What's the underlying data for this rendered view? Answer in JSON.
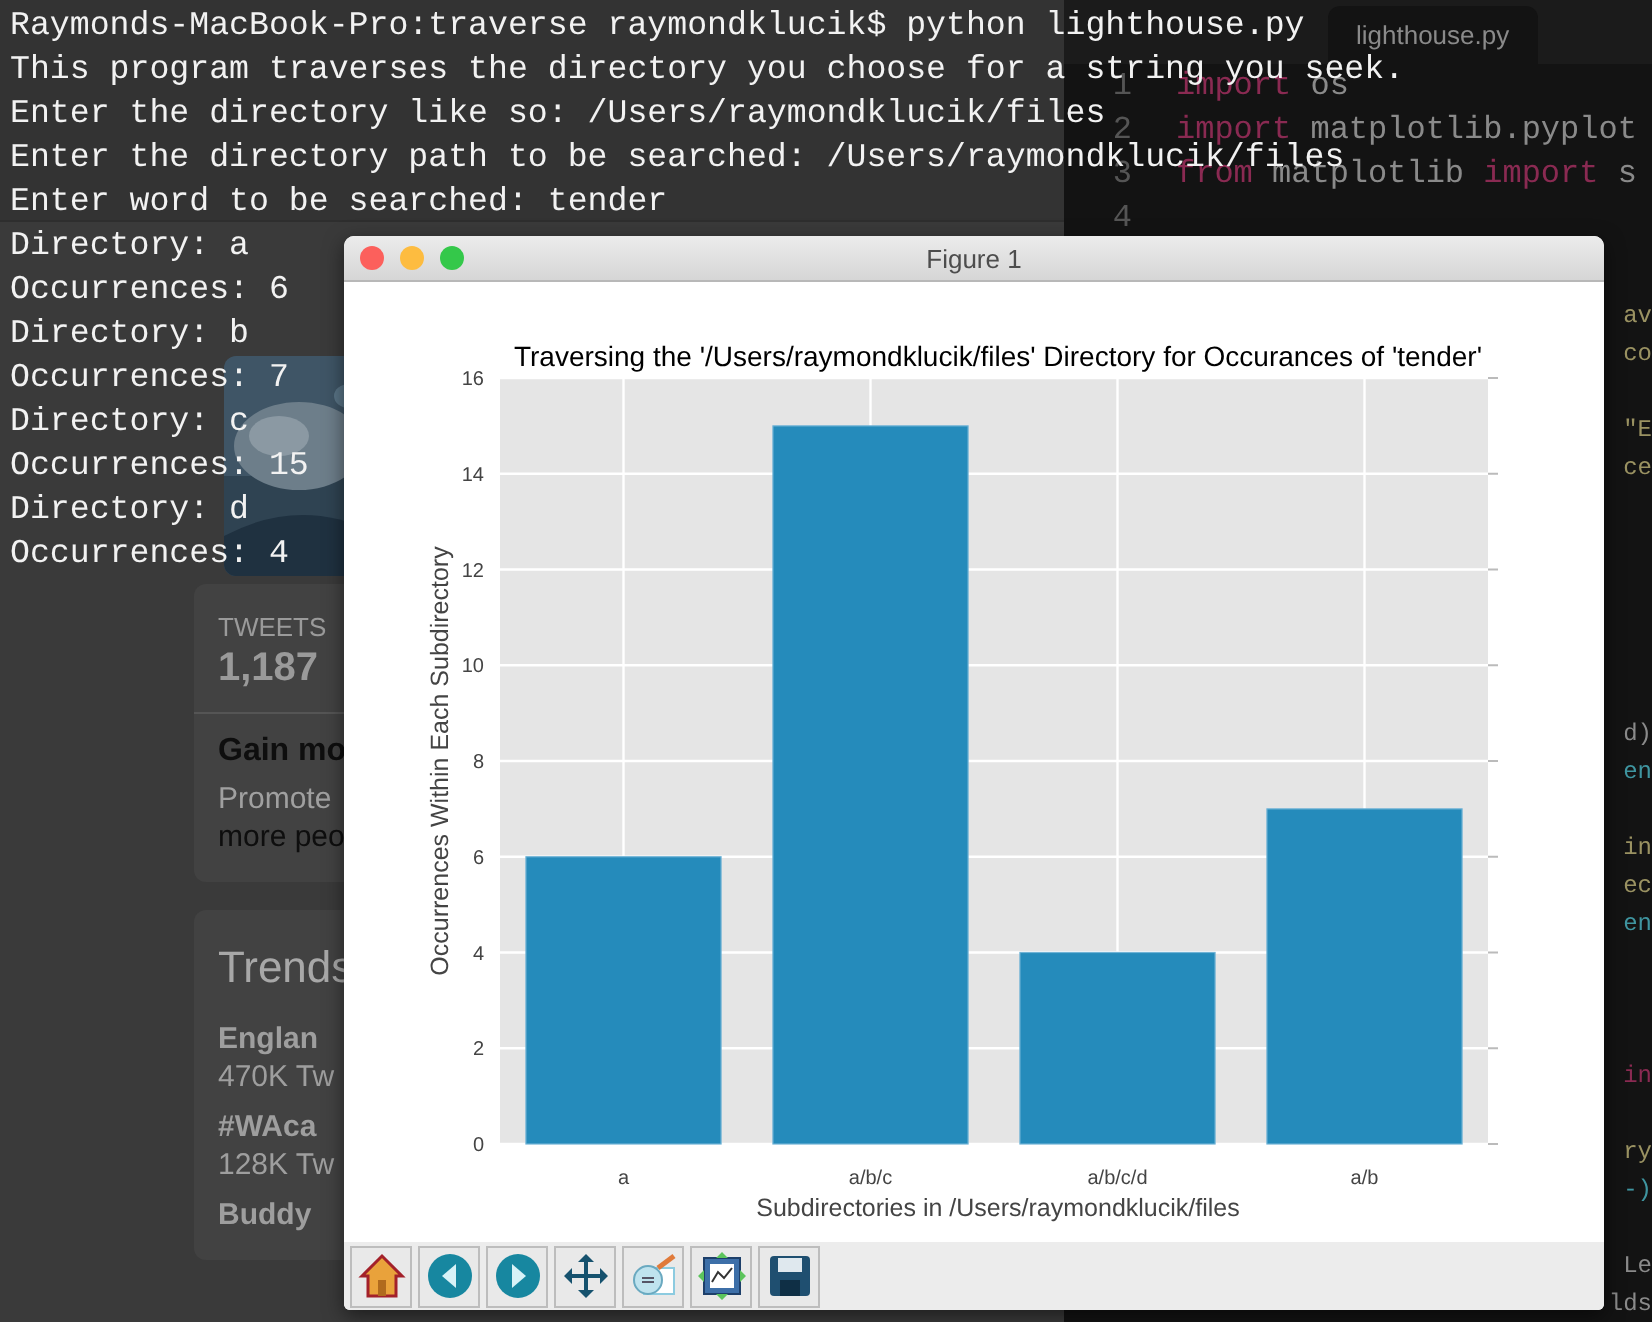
{
  "terminal": {
    "lines": [
      "Raymonds-MacBook-Pro:traverse raymondklucik$ python lighthouse.py",
      "This program traverses the directory you choose for a string you seek.",
      "Enter the directory like so: /Users/raymondklucik/files",
      "Enter the directory path to be searched: /Users/raymondklucik/files",
      "Enter word to be searched: tender",
      "Directory: a",
      "Occurrences: 6",
      "Directory: b",
      "Occurrences: 7",
      "Directory: c",
      "Occurrences: 15",
      "Directory: d",
      "Occurrences: 4"
    ]
  },
  "browser": {
    "stats_label": "TWEETS",
    "stats_value": "1,187",
    "promo": {
      "title": "Gain mo",
      "text_1": "Promote",
      "text_2": "more peo"
    },
    "trends": {
      "title": "Trends",
      "items": [
        {
          "name": "Englan",
          "count": "470K Tw"
        },
        {
          "name": "#WAca",
          "count": "128K Tw"
        },
        {
          "name": "Buddy"
        }
      ]
    }
  },
  "editor": {
    "tab": {
      "label": "lighthouse.py"
    },
    "lines": [
      {
        "number": "1",
        "tokens": [
          {
            "kind": "keyword",
            "text": "import"
          },
          {
            "kind": "plain",
            "text": " os"
          }
        ]
      },
      {
        "number": "2",
        "tokens": [
          {
            "kind": "keyword",
            "text": "import"
          },
          {
            "kind": "plain",
            "text": " matplotlib.pyplot"
          }
        ]
      },
      {
        "number": "3",
        "tokens": [
          {
            "kind": "keyword",
            "text": "from"
          },
          {
            "kind": "plain",
            "text": " matplotlib "
          },
          {
            "kind": "keyword",
            "text": "import"
          },
          {
            "kind": "plain",
            "text": " s"
          }
        ]
      },
      {
        "number": "4"
      }
    ],
    "fragments": [
      {
        "kind": "string",
        "text": "av"
      },
      {
        "kind": "string",
        "text": "co"
      },
      {
        "kind": "string",
        "text": "\"E"
      },
      {
        "kind": "string",
        "text": "ce"
      },
      {
        "kind": "plain",
        "text": "d)"
      },
      {
        "kind": "call",
        "text": "en"
      },
      {
        "kind": "string",
        "text": "in"
      },
      {
        "kind": "string",
        "text": "ec"
      },
      {
        "kind": "call",
        "text": "en"
      },
      {
        "kind": "keyword",
        "text": "in"
      },
      {
        "kind": "string",
        "text": "ry"
      },
      {
        "kind": "call",
        "text": "-)"
      },
      {
        "kind": "plain",
        "text": "Le"
      },
      {
        "kind": "plain",
        "text": "lds"
      }
    ]
  },
  "figure": {
    "title": "Figure 1",
    "chart_data": {
      "type": "bar",
      "title": "Traversing the '/Users/raymondklucik/files' Directory for Occurances of 'tender'",
      "xlabel": "Subdirectories in /Users/raymondklucik/files",
      "ylabel": "Occurrences Within Each Subdirectory",
      "categories": [
        "a",
        "a/b/c",
        "a/b/c/d",
        "a/b"
      ],
      "series": [
        {
          "color": "#258bbb",
          "values": [
            6,
            15,
            4,
            7
          ]
        }
      ],
      "ylim": [
        0,
        16
      ],
      "yticks": [
        0,
        2,
        4,
        6,
        8,
        10,
        12,
        14,
        16
      ],
      "grid": true
    },
    "toolbar": [
      {
        "kind": "home"
      },
      {
        "kind": "back"
      },
      {
        "kind": "forward"
      },
      {
        "kind": "pan"
      },
      {
        "kind": "zoom"
      },
      {
        "kind": "subplots"
      },
      {
        "kind": "save"
      }
    ]
  }
}
